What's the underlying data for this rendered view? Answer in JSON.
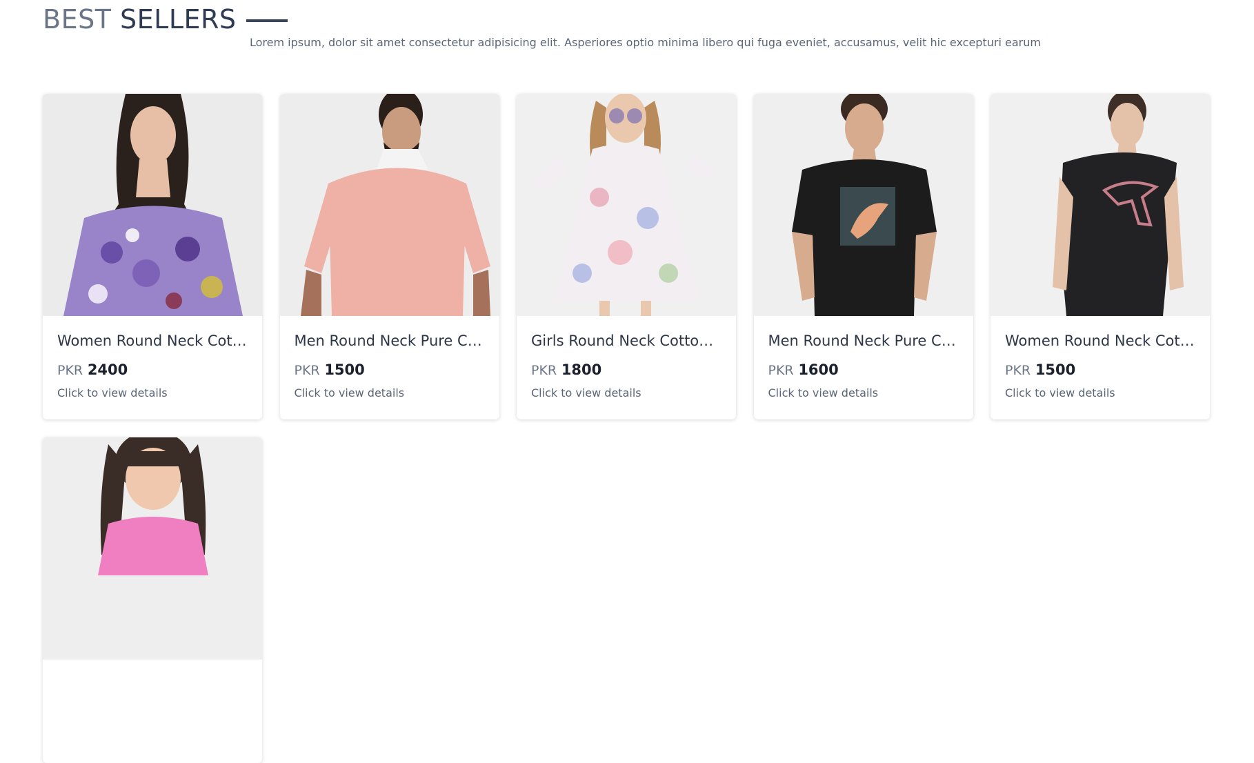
{
  "section": {
    "title_part1": "BEST",
    "title_part2": "SELLERS",
    "subtitle": "Lorem ipsum, dolor sit amet consectetur adipisicing elit. Asperiores optio minima libero qui fuga eveniet, accusamus, velit hic excepturi earum"
  },
  "products": [
    {
      "name": "Women Round Neck Cott...",
      "currency": "PKR",
      "price": "2400",
      "cta": "Click to view details"
    },
    {
      "name": "Men Round Neck Pure Co...",
      "currency": "PKR",
      "price": "1500",
      "cta": "Click to view details"
    },
    {
      "name": "Girls Round Neck Cotton T...",
      "currency": "PKR",
      "price": "1800",
      "cta": "Click to view details"
    },
    {
      "name": "Men Round Neck Pure Co...",
      "currency": "PKR",
      "price": "1600",
      "cta": "Click to view details"
    },
    {
      "name": "Women Round Neck Cott...",
      "currency": "PKR",
      "price": "1500",
      "cta": "Click to view details"
    },
    {
      "name": "",
      "currency": "",
      "price": "",
      "cta": ""
    }
  ],
  "colors": {
    "title_light": "#6b7588",
    "title_dark": "#2f3b52",
    "price_text": "#1a202c"
  }
}
